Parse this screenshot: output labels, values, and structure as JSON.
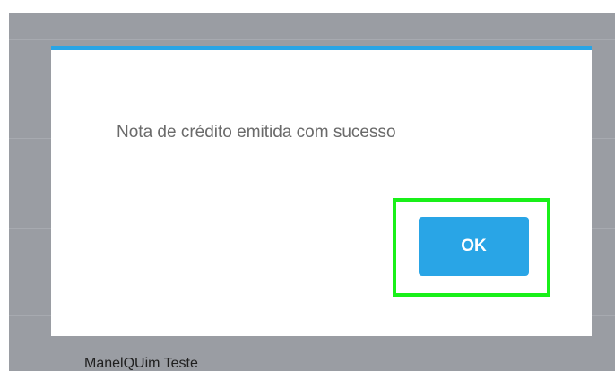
{
  "background_page": {
    "row_text": "ManelQUim Teste"
  },
  "modal": {
    "message": "Nota de crédito emitida com sucesso",
    "ok_label": "OK"
  },
  "colors": {
    "accent": "#29a5e6",
    "highlight": "#19f019",
    "overlay": "#9a9da3"
  }
}
